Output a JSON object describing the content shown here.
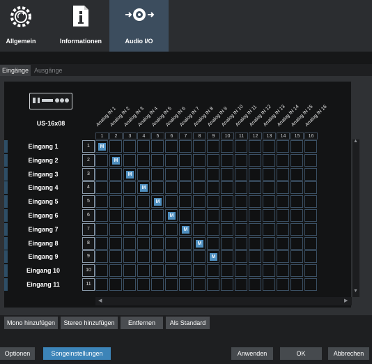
{
  "top_tabs": [
    {
      "label": "Allgemein",
      "icon": "gear-sync-icon"
    },
    {
      "label": "Informationen",
      "icon": "info-document-icon"
    },
    {
      "label": "Audio I/O",
      "icon": "speaker-io-icon"
    }
  ],
  "sub_tabs": {
    "inputs": "Eingänge",
    "outputs": "Ausgänge"
  },
  "device": {
    "name": "US-16x08"
  },
  "columns": [
    "Analog IN 1",
    "Analog IN 2",
    "Analog IN 3",
    "Analog IN 4",
    "Analog IN 5",
    "Analog IN 6",
    "Analog IN 7",
    "Analog IN 8",
    "Analog IN 9",
    "Analog IN 10",
    "Analog IN 11",
    "Analog IN 12",
    "Analog IN 13",
    "Analog IN 14",
    "Analog IN 15",
    "Analog IN 16"
  ],
  "column_numbers": [
    "1",
    "2",
    "3",
    "4",
    "5",
    "6",
    "7",
    "8",
    "9",
    "10",
    "11",
    "12",
    "13",
    "14",
    "15",
    "16"
  ],
  "rows": [
    {
      "label": "Eingang 1",
      "num": "1"
    },
    {
      "label": "Eingang 2",
      "num": "2"
    },
    {
      "label": "Eingang 3",
      "num": "3"
    },
    {
      "label": "Eingang 4",
      "num": "4"
    },
    {
      "label": "Eingang 5",
      "num": "5"
    },
    {
      "label": "Eingang 6",
      "num": "6"
    },
    {
      "label": "Eingang 7",
      "num": "7"
    },
    {
      "label": "Eingang 8",
      "num": "8"
    },
    {
      "label": "Eingang 9",
      "num": "9"
    },
    {
      "label": "Eingang 10",
      "num": "10"
    },
    {
      "label": "Eingang 11",
      "num": "11"
    }
  ],
  "assigned_mark": "M",
  "assignments": [
    [
      0,
      0
    ],
    [
      1,
      1
    ],
    [
      2,
      2
    ],
    [
      3,
      3
    ],
    [
      4,
      4
    ],
    [
      5,
      5
    ],
    [
      6,
      6
    ],
    [
      7,
      7
    ],
    [
      8,
      8
    ]
  ],
  "matrix_buttons": {
    "mono": "Mono hinzufügen",
    "stereo": "Stereo hinzufügen",
    "remove": "Entfernen",
    "default": "Als Standard"
  },
  "footer": {
    "options": "Optionen",
    "song_settings": "Songeinstellungen",
    "apply": "Anwenden",
    "ok": "OK",
    "cancel": "Abbrechen"
  },
  "colors": {
    "accent": "#3c84b8",
    "mono_mark": "#4f8fbf",
    "active_tab": "#3c4d5e"
  }
}
